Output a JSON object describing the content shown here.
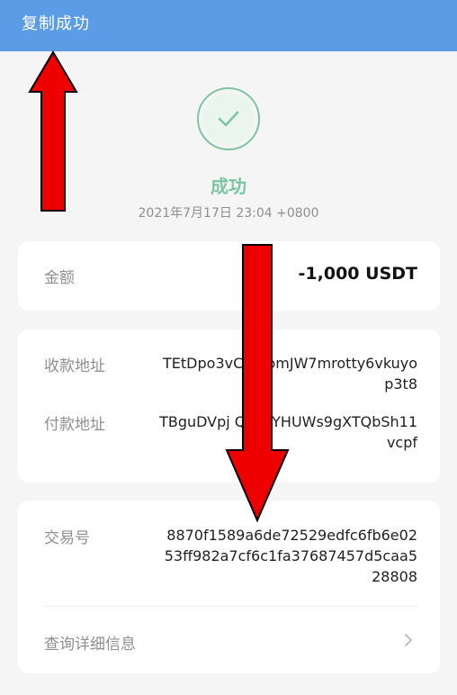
{
  "toast": {
    "text": "复制成功"
  },
  "status": {
    "title": "成功",
    "timestamp": "2021年7月17日 23:04 +0800",
    "accent_color": "#7dc4a3",
    "icon": "check-circle-icon"
  },
  "amount": {
    "label": "金额",
    "value": "-1,000 USDT"
  },
  "addresses": {
    "receive_label": "收款地址",
    "receive_value": "TEtDpo3vC   V4omJW7mrotty6vkuyop3t8",
    "pay_label": "付款地址",
    "pay_value": "TBguDVpj     Q41zYHUWs9gXTQbSh11vcpf"
  },
  "transaction": {
    "label": "交易号",
    "value": "8870f1589a6de72529edfc6fb6e0253ff982a7cf6c1fa37687457d5caa528808"
  },
  "details": {
    "label": "查询详细信息",
    "icon": "chevron-right-icon"
  },
  "annotations": {
    "arrow_color": "#ee0000",
    "arrows": [
      "arrow-up-icon",
      "arrow-down-icon"
    ]
  },
  "colors": {
    "toast_bg": "#5a9de6",
    "page_bg": "#f5f5f5",
    "label_gray": "#8f8f8f"
  }
}
